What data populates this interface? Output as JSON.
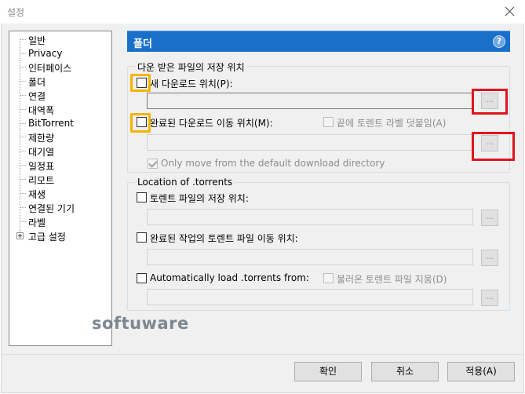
{
  "window": {
    "title": "설정"
  },
  "sidebar": {
    "items": [
      {
        "label": "일반"
      },
      {
        "label": "Privacy"
      },
      {
        "label": "인터페이스"
      },
      {
        "label": "폴더"
      },
      {
        "label": "연결"
      },
      {
        "label": "대역폭"
      },
      {
        "label": "BitTorrent"
      },
      {
        "label": "제한량"
      },
      {
        "label": "대기열"
      },
      {
        "label": "일정표"
      },
      {
        "label": "리모트"
      },
      {
        "label": "재생"
      },
      {
        "label": "연결된 기기"
      },
      {
        "label": "라벨"
      },
      {
        "label": "고급 설정"
      }
    ],
    "selected": "폴더"
  },
  "panel": {
    "title": "폴더",
    "help_icon": "?",
    "downloads_group": {
      "legend": "다운 받은 파일의 저장 위치",
      "new_download_label": "새 다운로드 위치(P):",
      "new_download_checked": false,
      "new_download_path": "",
      "move_completed_label": "완료된 다운로드 이동 위치(M):",
      "move_completed_checked": false,
      "append_label_label": "끝에 토렌트 라벨 덧붙임(A)",
      "append_label_checked": false,
      "move_completed_path": "",
      "only_move_label": "Only move from the default download directory",
      "only_move_checked": true,
      "browse_label": "..."
    },
    "torrents_group": {
      "legend": "Location of .torrents",
      "store_label": "토렌트 파일의 저장 위치:",
      "store_checked": false,
      "store_path": "",
      "move_finished_label": "완료된 작업의 토렌트 파일 이동 위치:",
      "move_finished_checked": false,
      "move_finished_path": "",
      "autoload_label": "Automatically load .torrents from:",
      "autoload_checked": false,
      "delete_loaded_label": "불러온 토렌트 파일 지움(D)",
      "delete_loaded_checked": false,
      "autoload_path": "",
      "browse_label": "..."
    }
  },
  "watermark": "softuware",
  "buttons": {
    "ok": "확인",
    "cancel": "취소",
    "apply": "적용(A)"
  },
  "colors": {
    "header_blue": "#1a6fc9",
    "highlight_yellow": "#f5b400",
    "highlight_red": "#e0141e"
  }
}
